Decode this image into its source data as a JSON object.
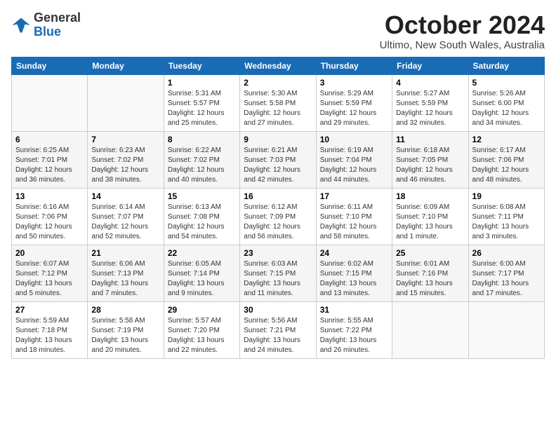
{
  "logo": {
    "general": "General",
    "blue": "Blue"
  },
  "header": {
    "month": "October 2024",
    "location": "Ultimo, New South Wales, Australia"
  },
  "weekdays": [
    "Sunday",
    "Monday",
    "Tuesday",
    "Wednesday",
    "Thursday",
    "Friday",
    "Saturday"
  ],
  "weeks": [
    [
      {
        "day": "",
        "info": ""
      },
      {
        "day": "",
        "info": ""
      },
      {
        "day": "1",
        "info": "Sunrise: 5:31 AM\nSunset: 5:57 PM\nDaylight: 12 hours\nand 25 minutes."
      },
      {
        "day": "2",
        "info": "Sunrise: 5:30 AM\nSunset: 5:58 PM\nDaylight: 12 hours\nand 27 minutes."
      },
      {
        "day": "3",
        "info": "Sunrise: 5:29 AM\nSunset: 5:59 PM\nDaylight: 12 hours\nand 29 minutes."
      },
      {
        "day": "4",
        "info": "Sunrise: 5:27 AM\nSunset: 5:59 PM\nDaylight: 12 hours\nand 32 minutes."
      },
      {
        "day": "5",
        "info": "Sunrise: 5:26 AM\nSunset: 6:00 PM\nDaylight: 12 hours\nand 34 minutes."
      }
    ],
    [
      {
        "day": "6",
        "info": "Sunrise: 6:25 AM\nSunset: 7:01 PM\nDaylight: 12 hours\nand 36 minutes."
      },
      {
        "day": "7",
        "info": "Sunrise: 6:23 AM\nSunset: 7:02 PM\nDaylight: 12 hours\nand 38 minutes."
      },
      {
        "day": "8",
        "info": "Sunrise: 6:22 AM\nSunset: 7:02 PM\nDaylight: 12 hours\nand 40 minutes."
      },
      {
        "day": "9",
        "info": "Sunrise: 6:21 AM\nSunset: 7:03 PM\nDaylight: 12 hours\nand 42 minutes."
      },
      {
        "day": "10",
        "info": "Sunrise: 6:19 AM\nSunset: 7:04 PM\nDaylight: 12 hours\nand 44 minutes."
      },
      {
        "day": "11",
        "info": "Sunrise: 6:18 AM\nSunset: 7:05 PM\nDaylight: 12 hours\nand 46 minutes."
      },
      {
        "day": "12",
        "info": "Sunrise: 6:17 AM\nSunset: 7:06 PM\nDaylight: 12 hours\nand 48 minutes."
      }
    ],
    [
      {
        "day": "13",
        "info": "Sunrise: 6:16 AM\nSunset: 7:06 PM\nDaylight: 12 hours\nand 50 minutes."
      },
      {
        "day": "14",
        "info": "Sunrise: 6:14 AM\nSunset: 7:07 PM\nDaylight: 12 hours\nand 52 minutes."
      },
      {
        "day": "15",
        "info": "Sunrise: 6:13 AM\nSunset: 7:08 PM\nDaylight: 12 hours\nand 54 minutes."
      },
      {
        "day": "16",
        "info": "Sunrise: 6:12 AM\nSunset: 7:09 PM\nDaylight: 12 hours\nand 56 minutes."
      },
      {
        "day": "17",
        "info": "Sunrise: 6:11 AM\nSunset: 7:10 PM\nDaylight: 12 hours\nand 58 minutes."
      },
      {
        "day": "18",
        "info": "Sunrise: 6:09 AM\nSunset: 7:10 PM\nDaylight: 13 hours\nand 1 minute."
      },
      {
        "day": "19",
        "info": "Sunrise: 6:08 AM\nSunset: 7:11 PM\nDaylight: 13 hours\nand 3 minutes."
      }
    ],
    [
      {
        "day": "20",
        "info": "Sunrise: 6:07 AM\nSunset: 7:12 PM\nDaylight: 13 hours\nand 5 minutes."
      },
      {
        "day": "21",
        "info": "Sunrise: 6:06 AM\nSunset: 7:13 PM\nDaylight: 13 hours\nand 7 minutes."
      },
      {
        "day": "22",
        "info": "Sunrise: 6:05 AM\nSunset: 7:14 PM\nDaylight: 13 hours\nand 9 minutes."
      },
      {
        "day": "23",
        "info": "Sunrise: 6:03 AM\nSunset: 7:15 PM\nDaylight: 13 hours\nand 11 minutes."
      },
      {
        "day": "24",
        "info": "Sunrise: 6:02 AM\nSunset: 7:15 PM\nDaylight: 13 hours\nand 13 minutes."
      },
      {
        "day": "25",
        "info": "Sunrise: 6:01 AM\nSunset: 7:16 PM\nDaylight: 13 hours\nand 15 minutes."
      },
      {
        "day": "26",
        "info": "Sunrise: 6:00 AM\nSunset: 7:17 PM\nDaylight: 13 hours\nand 17 minutes."
      }
    ],
    [
      {
        "day": "27",
        "info": "Sunrise: 5:59 AM\nSunset: 7:18 PM\nDaylight: 13 hours\nand 18 minutes."
      },
      {
        "day": "28",
        "info": "Sunrise: 5:58 AM\nSunset: 7:19 PM\nDaylight: 13 hours\nand 20 minutes."
      },
      {
        "day": "29",
        "info": "Sunrise: 5:57 AM\nSunset: 7:20 PM\nDaylight: 13 hours\nand 22 minutes."
      },
      {
        "day": "30",
        "info": "Sunrise: 5:56 AM\nSunset: 7:21 PM\nDaylight: 13 hours\nand 24 minutes."
      },
      {
        "day": "31",
        "info": "Sunrise: 5:55 AM\nSunset: 7:22 PM\nDaylight: 13 hours\nand 26 minutes."
      },
      {
        "day": "",
        "info": ""
      },
      {
        "day": "",
        "info": ""
      }
    ]
  ]
}
